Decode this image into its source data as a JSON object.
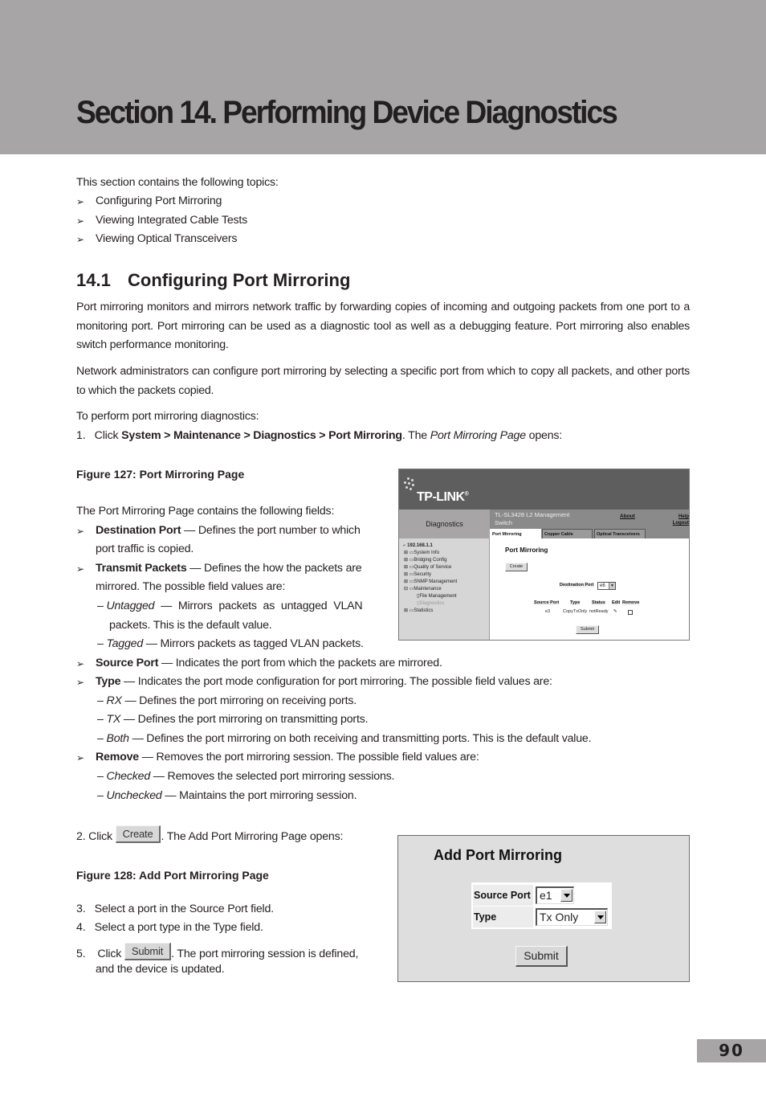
{
  "section": {
    "title": "Section 14.  Performing Device Diagnostics"
  },
  "intro": {
    "lead": "This section contains the following topics:",
    "bullet_glyph": "➢",
    "topics": [
      "Configuring Port Mirroring",
      "Viewing Integrated Cable Tests",
      "Viewing Optical Transceivers"
    ]
  },
  "subsection": {
    "number": "14.1",
    "title": "Configuring Port Mirroring",
    "para1": "Port mirroring monitors and mirrors network traffic by forwarding copies of incoming and outgoing packets from one port to a monitoring port. Port mirroring can be used as a diagnostic tool as well as a debugging feature. Port mirroring also enables switch performance monitoring.",
    "para2": "Network administrators can configure port mirroring by selecting a specific port from which to copy all packets, and other ports to which the packets copied.",
    "para3": "To perform port mirroring diagnostics:",
    "step1": {
      "num": "1.",
      "prefix": "Click ",
      "path": "System > Maintenance > Diagnostics > Port Mirroring",
      "mid": ". The ",
      "page": "Port Mirroring Page",
      "suffix": " opens:"
    }
  },
  "figure127": {
    "caption": "Figure 127: Port Mirroring Page",
    "fields_intro": "The Port Mirroring Page contains the following fields:",
    "fields": [
      {
        "name": "Destination Port",
        "desc1": " — Defines the port number to which",
        "desc2": "port traffic is copied."
      },
      {
        "name": "Transmit Packets",
        "desc1": " — Defines the how the packets are",
        "desc2": "mirrored. The possible field values are:"
      }
    ],
    "transmit_values": [
      {
        "name": "Untagged",
        "desc1": " — Mirrors packets as untagged VLAN",
        "desc2": "packets. This is the default value."
      },
      {
        "name": "Tagged",
        "desc1": " — Mirrors packets as tagged VLAN packets."
      }
    ],
    "screenshot": {
      "logo": "TP-LINK",
      "logo_mark": "®",
      "side_heading": "Diagnostics",
      "model": "TL-SL3428 L2 Management Switch",
      "about": "About",
      "help": "Help",
      "logout": "Logout",
      "tabs": [
        "Port Mirroring",
        "Copper Cable",
        "Optical Transceivers"
      ],
      "tree": {
        "root": "192.168.1.1",
        "items": [
          "System Info",
          "Bridging Config",
          "Quality of Service",
          "Security",
          "SNMP Management",
          "Maintenance",
          "File Management",
          "Diagnostics",
          "Statistics"
        ]
      },
      "page_title": "Port Mirroring",
      "create_button": "Create",
      "destination_label": "Destination Port",
      "destination_value": "e6",
      "table_headers": [
        "Source Port",
        "Type",
        "Status",
        "Edit",
        "Remove"
      ],
      "table_row": {
        "source_port": "e3",
        "type": "CopyTxOnly",
        "status": "notReady"
      },
      "submit_button": "Submit"
    }
  },
  "fields_more": [
    {
      "name": "Source Port",
      "desc": " — Indicates the port from which the packets are mirrored."
    },
    {
      "name": "Type",
      "desc": " — Indicates the port mode configuration for port mirroring. The possible field values are:"
    }
  ],
  "type_values": [
    {
      "name": "RX",
      "desc": " — Defines the port mirroring on receiving ports."
    },
    {
      "name": "TX",
      "desc": " — Defines the port mirroring on transmitting ports."
    },
    {
      "name": "Both",
      "desc": " — Defines the port mirroring on both receiving and transmitting ports. This is the default value."
    }
  ],
  "remove_field": {
    "name": "Remove",
    "desc": " — Removes the port mirroring session. The possible field values are:"
  },
  "remove_values": [
    {
      "name": "Checked",
      "desc": " — Removes the selected port mirroring sessions."
    },
    {
      "name": "Unchecked",
      "desc": " — Maintains the port mirroring session."
    }
  ],
  "step2": {
    "prefix": "2. Click ",
    "button": "Create",
    "suffix": ". The Add Port Mirroring Page opens:"
  },
  "figure128": {
    "caption": "Figure 128: Add Port Mirroring Page",
    "title": "Add Port Mirroring",
    "source_port_label": "Source Port",
    "source_port_value": "e1",
    "type_label": "Type",
    "type_value": "Tx Only",
    "submit_button": "Submit"
  },
  "steps_after": {
    "step3": {
      "num": "3.",
      "text": "Select a port in the Source Port field."
    },
    "step4": {
      "num": "4.",
      "text": "Select a port type in the Type field."
    },
    "step5": {
      "num": "5.",
      "prefix": "Click ",
      "button": "Submit",
      "suffix": ". The port mirroring session is defined,",
      "line2": "and the device is updated."
    }
  },
  "page_number": "90"
}
